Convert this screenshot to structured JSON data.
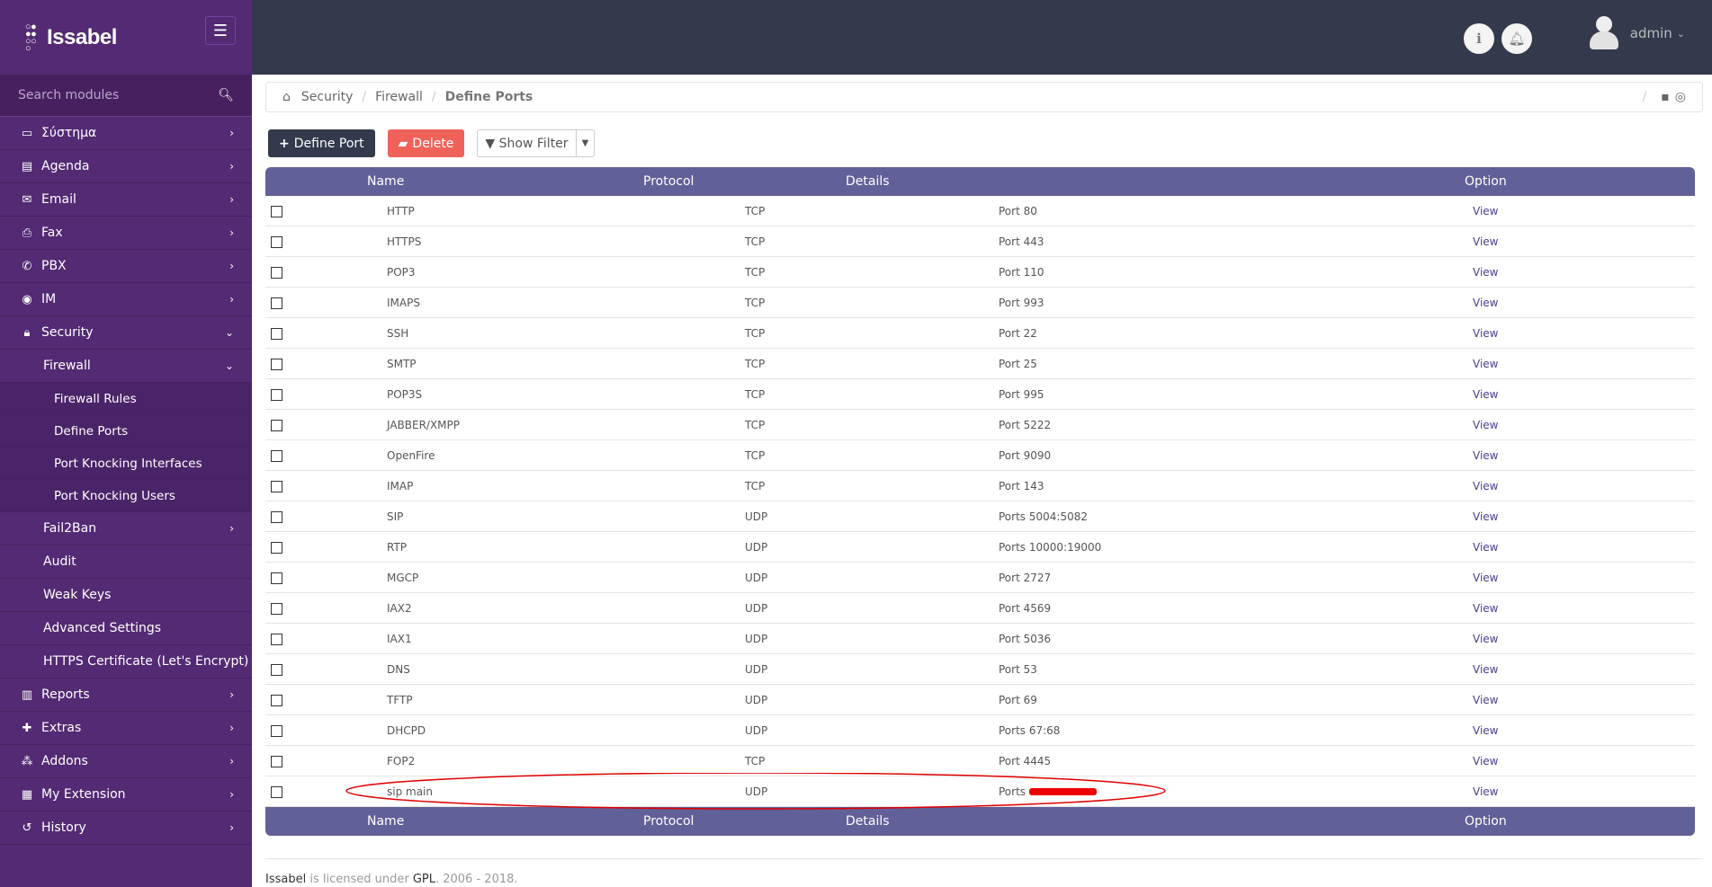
{
  "app": {
    "logo": "Issabel"
  },
  "sidebar": {
    "search_placeholder": "Search modules",
    "items": [
      {
        "label": "Σύστημα",
        "icon": "laptop-icon"
      },
      {
        "label": "Agenda",
        "icon": "book-icon"
      },
      {
        "label": "Email",
        "icon": "envelope-icon"
      },
      {
        "label": "Fax",
        "icon": "printer-icon"
      },
      {
        "label": "PBX",
        "icon": "phone-icon"
      },
      {
        "label": "IM",
        "icon": "chat-icon"
      },
      {
        "label": "Security",
        "icon": "lock-icon"
      }
    ],
    "security_sub": {
      "firewall": "Firewall",
      "firewall_items": [
        "Firewall Rules",
        "Define Ports",
        "Port Knocking Interfaces",
        "Port Knocking Users"
      ],
      "others": [
        "Fail2Ban",
        "Audit",
        "Weak Keys",
        "Advanced Settings",
        "HTTPS Certificate (Let's Encrypt)"
      ]
    },
    "items_after": [
      {
        "label": "Reports",
        "icon": "chart-icon"
      },
      {
        "label": "Extras",
        "icon": "plus-icon"
      },
      {
        "label": "Addons",
        "icon": "cubes-icon"
      },
      {
        "label": "My Extension",
        "icon": "extension-icon"
      },
      {
        "label": "History",
        "icon": "history-icon"
      }
    ]
  },
  "topbar": {
    "user": "admin"
  },
  "breadcrumb": [
    "Security",
    "Firewall",
    "Define Ports"
  ],
  "toolbar": {
    "define_port": "Define Port",
    "delete": "Delete",
    "show_filter": "Show Filter"
  },
  "table": {
    "headers": [
      "Name",
      "Protocol",
      "Details",
      "Option"
    ],
    "rows": [
      [
        "HTTP",
        "TCP",
        "Port 80",
        "View"
      ],
      [
        "HTTPS",
        "TCP",
        "Port 443",
        "View"
      ],
      [
        "POP3",
        "TCP",
        "Port 110",
        "View"
      ],
      [
        "IMAPS",
        "TCP",
        "Port 993",
        "View"
      ],
      [
        "SSH",
        "TCP",
        "Port 22",
        "View"
      ],
      [
        "SMTP",
        "TCP",
        "Port 25",
        "View"
      ],
      [
        "POP3S",
        "TCP",
        "Port 995",
        "View"
      ],
      [
        "JABBER/XMPP",
        "TCP",
        "Port 5222",
        "View"
      ],
      [
        "OpenFire",
        "TCP",
        "Port 9090",
        "View"
      ],
      [
        "IMAP",
        "TCP",
        "Port 143",
        "View"
      ],
      [
        "SIP",
        "UDP",
        "Ports 5004:5082",
        "View"
      ],
      [
        "RTP",
        "UDP",
        "Ports 10000:19000",
        "View"
      ],
      [
        "MGCP",
        "UDP",
        "Port 2727",
        "View"
      ],
      [
        "IAX2",
        "UDP",
        "Port 4569",
        "View"
      ],
      [
        "IAX1",
        "UDP",
        "Port 5036",
        "View"
      ],
      [
        "DNS",
        "UDP",
        "Port 53",
        "View"
      ],
      [
        "TFTP",
        "UDP",
        "Port 69",
        "View"
      ],
      [
        "DHCPD",
        "UDP",
        "Ports 67:68",
        "View"
      ],
      [
        "FOP2",
        "TCP",
        "Port 4445",
        "View"
      ],
      [
        "sip main",
        "UDP",
        "Ports",
        "View"
      ]
    ]
  },
  "footer": {
    "brand": "Issabel",
    "text1": " is licensed under ",
    "license": "GPL",
    "text2": ". 2006 - 2018."
  },
  "colors": {
    "sidebar": "#532a73",
    "topbar": "#323a4c",
    "table_header": "#626098",
    "delete": "#ef625a",
    "annotation": "#e00000"
  }
}
